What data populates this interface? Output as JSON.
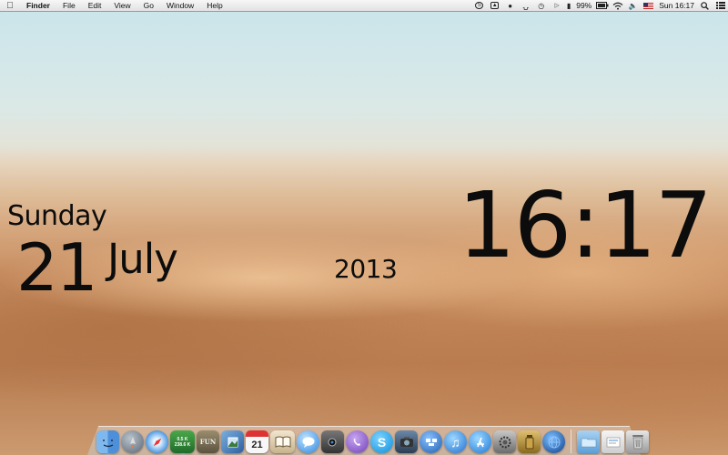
{
  "menubar": {
    "app_name": "Finder",
    "menus": [
      "File",
      "Edit",
      "View",
      "Go",
      "Window",
      "Help"
    ],
    "battery": "99%",
    "clock": "Sun 16:17",
    "status_icons": [
      "skype-icon",
      "screen-icon",
      "viber-icon",
      "headphones-icon",
      "time-machine-icon",
      "bluetooth-icon",
      "battery-icon",
      "wifi-icon",
      "volume-icon",
      "flag-icon",
      "spotlight-icon",
      "notification-icon"
    ]
  },
  "widget": {
    "day": "Sunday",
    "date": "21",
    "month": "July",
    "year": "2013",
    "time": "16:17"
  },
  "dock": {
    "calendar_day": "21",
    "network_up": "0.5 K",
    "network_down": "238.6 K",
    "font_label": "FUN"
  },
  "colors": {
    "sky": "#cfe6ea",
    "sand": "#c98f63",
    "text": "#0c0c0c"
  }
}
